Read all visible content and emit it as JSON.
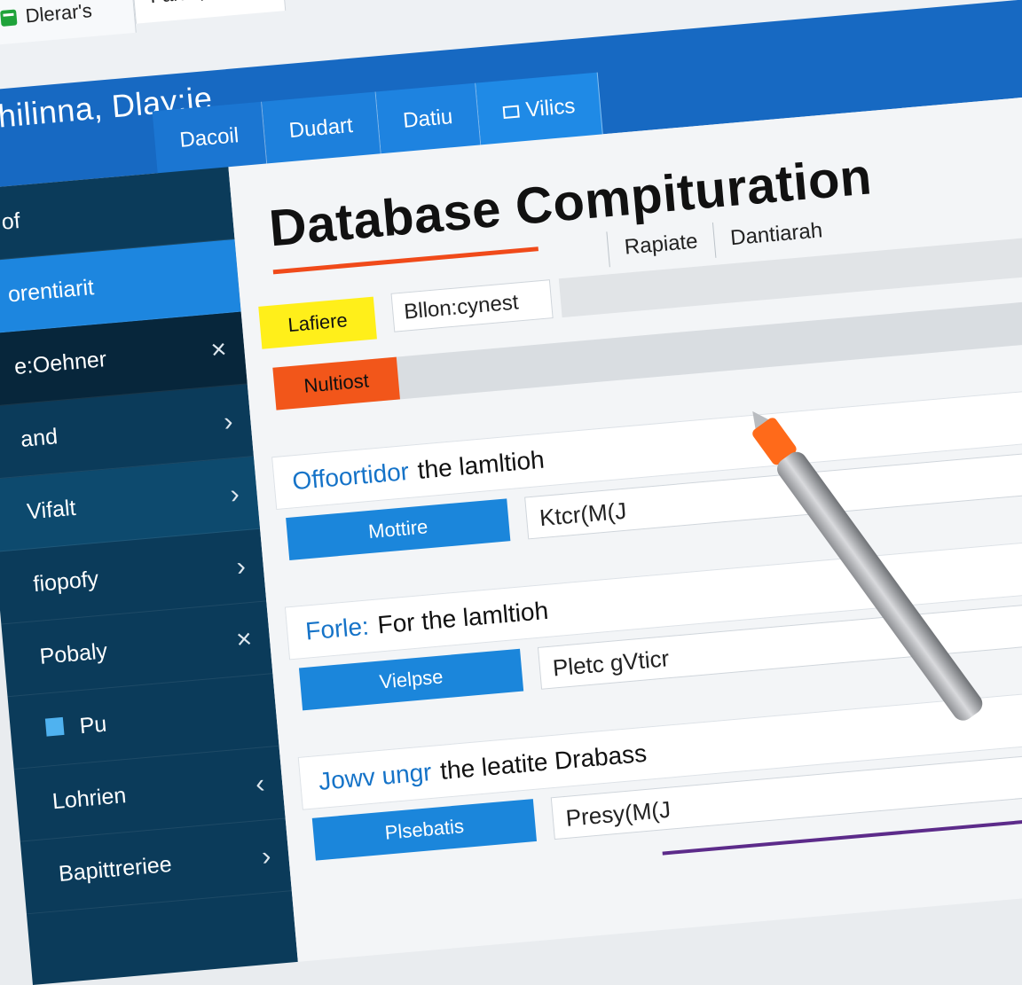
{
  "window": {
    "tabs": [
      {
        "label": "Dlerar's",
        "icon": "spreadsheet-icon",
        "icon_color": "#1fa33a"
      },
      {
        "label": "Faloh, -Put"
      }
    ]
  },
  "app": {
    "title": "Dhilinna, Dlay:ie",
    "nav_tabs": [
      {
        "label": "Dacoil"
      },
      {
        "label": "Dudart"
      },
      {
        "label": "Datiu"
      },
      {
        "label": "Vilics",
        "icon": "window-icon"
      }
    ]
  },
  "sidebar": {
    "items": [
      {
        "label": "of"
      },
      {
        "label": "orentiarit"
      },
      {
        "label": "e:Oehner",
        "action": "×"
      },
      {
        "label": "and",
        "action": "›"
      },
      {
        "label": "Vifalt",
        "action": "›"
      },
      {
        "label": "fiopofy",
        "action": "›"
      },
      {
        "label": "Pobaly",
        "action": "×"
      },
      {
        "label": "Pu",
        "icon": "export-icon"
      },
      {
        "label": "Lohrien",
        "action": "‹"
      },
      {
        "label": "Bapittreriee",
        "action": "›"
      }
    ]
  },
  "main": {
    "heading": "Database Compituration",
    "accent_color": "#f04a1a",
    "toolbar": {
      "button1": "Rapiate",
      "button2": "Dantiarah"
    },
    "filter_value": "Bllon:cynest",
    "chips": {
      "yellow": "Lafiere",
      "red": "Nultiost"
    },
    "sections": [
      {
        "keyword": "Offoortidor",
        "text": "the lamltioh",
        "button": "Mottire",
        "input": "Ktcr(M(J"
      },
      {
        "keyword": "Forle:",
        "text": "For the lamltioh",
        "button": "Vielpse",
        "input": "Pletc gVticr"
      },
      {
        "keyword": "Jowv ungr",
        "text": "the leatite Drabass",
        "button": "Plsebatis",
        "input": "Presy(M(J"
      }
    ]
  }
}
